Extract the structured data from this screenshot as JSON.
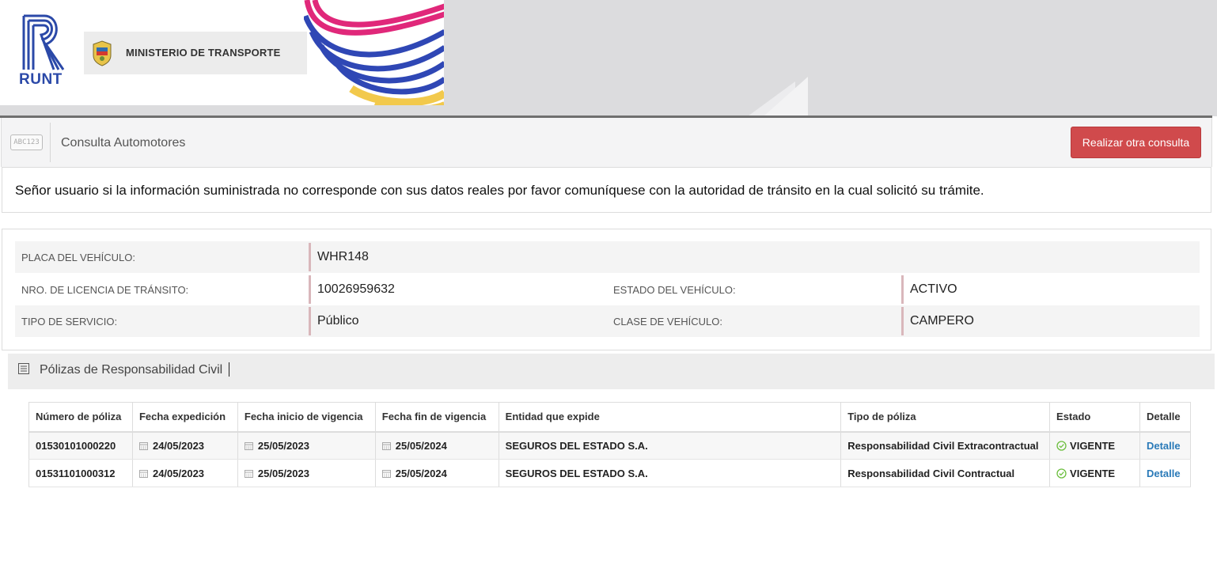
{
  "header": {
    "runt_label": "RUNT",
    "ministry_label": "MINISTERIO DE TRANSPORTE"
  },
  "toolbar": {
    "icon_label": "ABC123",
    "title": "Consulta Automotores",
    "new_query_button": "Realizar otra consulta"
  },
  "notice": "Señor usuario si la información suministrada no corresponde con sus datos reales por favor comuníquese con la autoridad de tránsito en la cual solicitó su trámite.",
  "vehicle": {
    "plate_label": "PLACA DEL VEHÍCULO:",
    "plate_value": "WHR148",
    "license_label": "NRO. DE LICENCIA DE TRÁNSITO:",
    "license_value": "10026959632",
    "status_label": "ESTADO DEL VEHÍCULO:",
    "status_value": "ACTIVO",
    "service_label": "TIPO DE SERVICIO:",
    "service_value": "Público",
    "class_label": "CLASE DE VEHÍCULO:",
    "class_value": "CAMPERO"
  },
  "policies": {
    "section_title": "Pólizas de Responsabilidad Civil",
    "columns": [
      "Número de póliza",
      "Fecha expedición",
      "Fecha inicio de vigencia",
      "Fecha fin de vigencia",
      "Entidad que expide",
      "Tipo de póliza",
      "Estado",
      "Detalle"
    ],
    "rows": [
      {
        "number": "01530101000220",
        "issued": "24/05/2023",
        "start": "25/05/2023",
        "end": "25/05/2024",
        "entity": "SEGUROS DEL ESTADO S.A.",
        "type": "Responsabilidad Civil Extracontractual",
        "state": "VIGENTE",
        "detail": "Detalle"
      },
      {
        "number": "01531101000312",
        "issued": "24/05/2023",
        "start": "25/05/2023",
        "end": "25/05/2024",
        "entity": "SEGUROS DEL ESTADO S.A.",
        "type": "Responsabilidad Civil Contractual",
        "state": "VIGENTE",
        "detail": "Detalle"
      }
    ]
  },
  "colors": {
    "accent_red": "#d04a4c",
    "runt_blue": "#2b49a8",
    "link_blue": "#2a7ab8",
    "valid_green": "#6dbf3f"
  },
  "icons": [
    "runt-logo-icon",
    "colombia-seal-icon",
    "abc123-icon",
    "list-icon",
    "calendar-icon",
    "check-circle-icon"
  ]
}
